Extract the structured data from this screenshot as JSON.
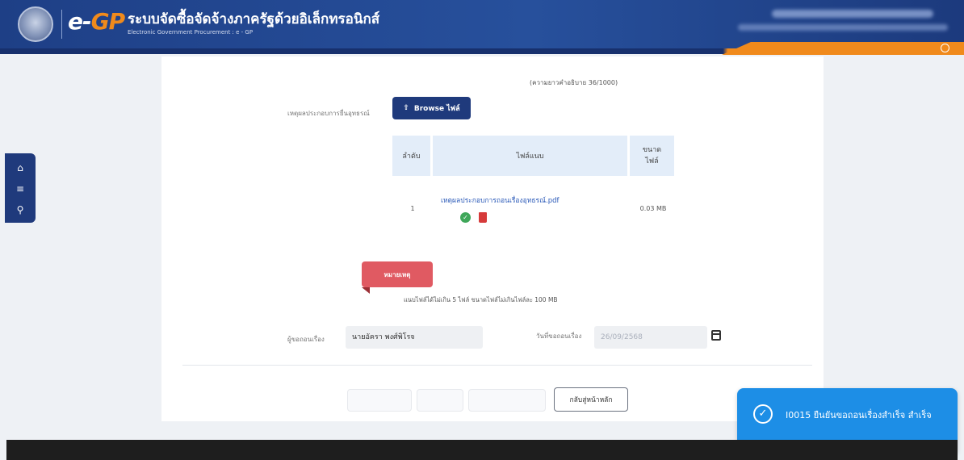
{
  "header": {
    "logo_e": "e-",
    "logo_gp": "GP",
    "title_th": "ระบบจัดซื้อจัดจ้างภาครัฐด้วยอิเล็กทรอนิกส์",
    "title_en": "Electronic Government Procurement : e - GP"
  },
  "form": {
    "char_count": "(ความยาวคำอธิบาย 36/1000)",
    "attach_label": "เหตุผลประกอบการยื่นอุทธรณ์",
    "browse_label": "Browse ไฟล์",
    "files_table": {
      "headers": [
        "ลำดับ",
        "ไฟล์แนบ",
        "ขนาด\nไฟล์"
      ],
      "rows": [
        {
          "index": "1",
          "filename": "เหตุผลประกอบการถอนเรื่องอุทธรณ์.pdf",
          "size": "0.03 MB"
        }
      ]
    },
    "note_tag": "หมายเหตุ",
    "note_text": "แนบไฟล์ได้ไม่เกิน 5 ไฟล์ ขนาดไฟล์ไม่เกินไฟล์ละ 100 MB",
    "reporter_label": "ผู้ขอถอนเรื่อง",
    "reporter_value": "นายอัครา พงศ์พิโรจ",
    "date_label": "วันที่ขอถอนเรื่อง",
    "date_value": "26/09/2568",
    "buttons": {
      "back": "กลับสู่หน้าหลัก"
    }
  },
  "toast": {
    "message": "I0015 ยืนยันขอถอนเรื่องสำเร็จ สำเร็จ"
  }
}
